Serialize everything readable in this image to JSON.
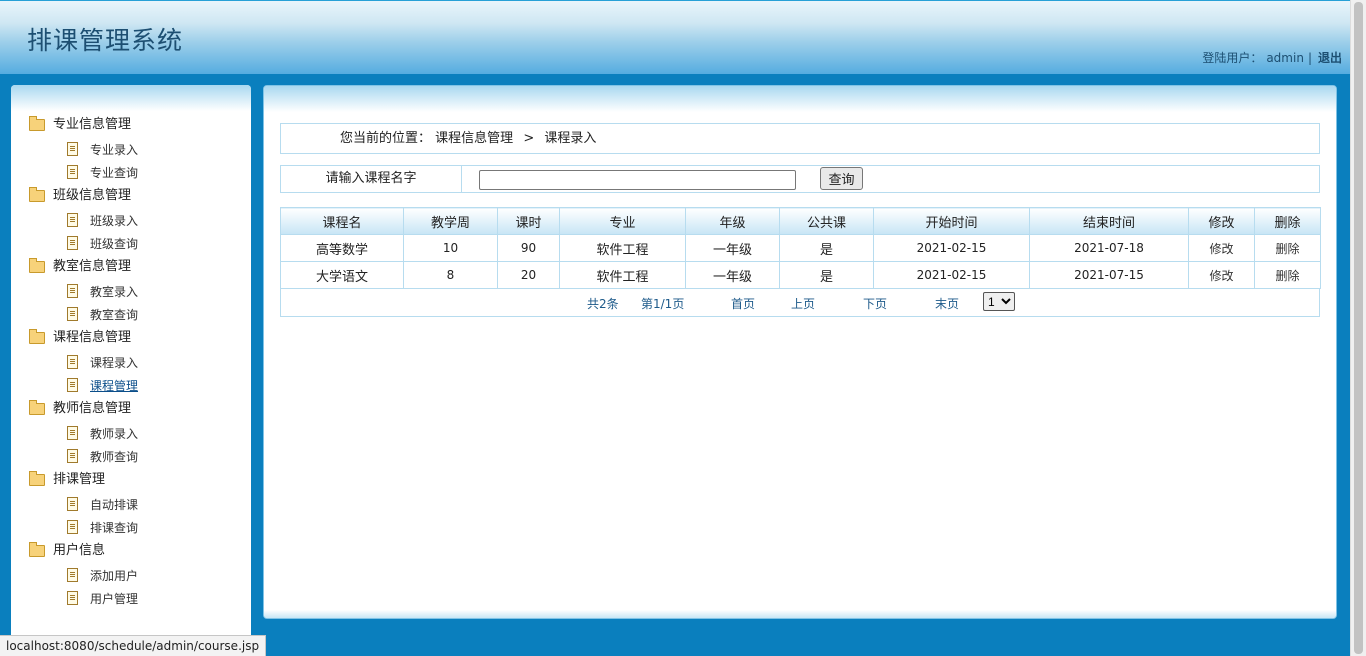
{
  "header": {
    "title": "排课管理系统",
    "user_label": "登陆用户：",
    "username": "admin",
    "separator": "|",
    "logout": "退出"
  },
  "sidebar": {
    "groups": [
      {
        "label": "专业信息管理",
        "items": [
          "专业录入",
          "专业查询"
        ]
      },
      {
        "label": "班级信息管理",
        "items": [
          "班级录入",
          "班级查询"
        ]
      },
      {
        "label": "教室信息管理",
        "items": [
          "教室录入",
          "教室查询"
        ]
      },
      {
        "label": "课程信息管理",
        "items": [
          "课程录入",
          "课程管理"
        ]
      },
      {
        "label": "教师信息管理",
        "items": [
          "教师录入",
          "教师查询"
        ]
      },
      {
        "label": "排课管理",
        "items": [
          "自动排课",
          "排课查询"
        ]
      },
      {
        "label": "用户信息",
        "items": [
          "添加用户",
          "用户管理"
        ]
      }
    ],
    "active_item": "课程管理"
  },
  "breadcrumb": {
    "prefix": "您当前的位置：",
    "level1": "课程信息管理",
    "sep": ">",
    "level2": "课程录入"
  },
  "search": {
    "label": "请输入课程名字",
    "value": "",
    "placeholder": "",
    "button": "查询"
  },
  "table": {
    "columns": [
      "课程名",
      "教学周",
      "课时",
      "专业",
      "年级",
      "公共课",
      "开始时间",
      "结束时间",
      "修改",
      "删除"
    ],
    "rows": [
      [
        "高等数学",
        "10",
        "90",
        "软件工程",
        "一年级",
        "是",
        "2021-02-15",
        "2021-07-18",
        "修改",
        "删除"
      ],
      [
        "大学语文",
        "8",
        "20",
        "软件工程",
        "一年级",
        "是",
        "2021-02-15",
        "2021-07-15",
        "修改",
        "删除"
      ]
    ]
  },
  "pager": {
    "total": "共2条",
    "page_info": "第1/1页",
    "first": "首页",
    "prev": "上页",
    "next": "下页",
    "last": "末页",
    "page_select": "1"
  },
  "status_url": "localhost:8080/schedule/admin/course.jsp",
  "colors": {
    "background": "#0a7fbe",
    "header_gradient_bottom": "#55ace0",
    "border": "#b7dcef",
    "link": "#1d5a8a"
  },
  "icons": {
    "group": "folder-open-icon",
    "item": "document-icon"
  }
}
